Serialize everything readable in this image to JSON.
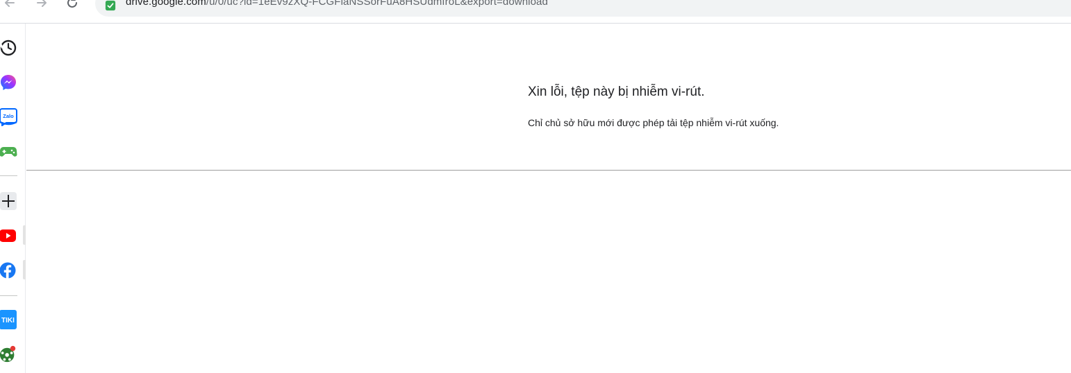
{
  "browser": {
    "url_host": "drive.google.com",
    "url_path": "/u/0/uc?id=1eEv9zXQ-FCGFlaNSSorFuA8HSUdmfroL&export=download",
    "nav": {
      "back_icon": "arrow-back-icon",
      "forward_icon": "arrow-forward-icon",
      "reload_icon": "reload-icon"
    },
    "secure_icon": "site-verified-icon",
    "secure_color": "#34a853"
  },
  "sidebar": {
    "items": [
      {
        "name": "history",
        "icon": "history-icon"
      },
      {
        "name": "messenger",
        "icon": "messenger-icon"
      },
      {
        "name": "zalo",
        "icon": "zalo-icon",
        "text": "Zalo"
      },
      {
        "name": "games",
        "icon": "gamepad-icon"
      },
      {
        "name": "add",
        "icon": "plus-icon"
      },
      {
        "name": "youtube",
        "icon": "youtube-icon"
      },
      {
        "name": "facebook",
        "icon": "facebook-icon"
      },
      {
        "name": "tiki",
        "icon": "tiki-icon",
        "text": "TIKI"
      },
      {
        "name": "soccer",
        "icon": "soccer-ball-icon"
      }
    ]
  },
  "page": {
    "title": "Xin lỗi, tệp này bị nhiễm vi-rút.",
    "description": "Chỉ chủ sở hữu mới được phép tải tệp nhiễm vi-rút xuống."
  }
}
